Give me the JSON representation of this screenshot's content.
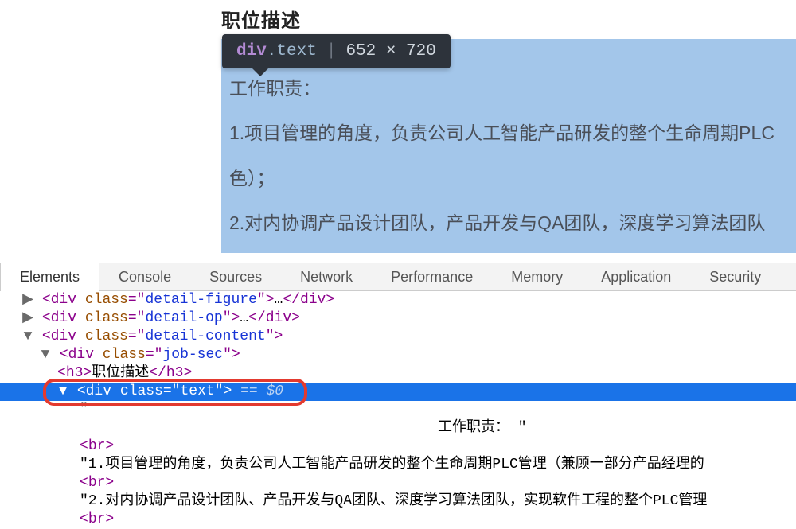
{
  "page": {
    "section_title": "职位描述",
    "highlight": {
      "line1": "工作职责：",
      "line2": "1.项目管理的角度，负责公司人工智能产品研发的整个生命周期PLC",
      "line3": "色）；",
      "line4": "2.对内协调产品设计团队，产品开发与QA团队，深度学习算法团队"
    }
  },
  "tooltip": {
    "tag": "div",
    "cls": ".text",
    "dims": "652 × 720"
  },
  "tabs": {
    "elements": "Elements",
    "console": "Console",
    "sources": "Sources",
    "network": "Network",
    "performance": "Performance",
    "memory": "Memory",
    "application": "Application",
    "security": "Security"
  },
  "dom": {
    "detail_figure": {
      "open": "<div class=\"detail-figure\">",
      "ell": "…",
      "close": "</div>"
    },
    "detail_op": {
      "open": "<div class=\"detail-op\">",
      "ell": "…",
      "close": "</div>"
    },
    "detail_content": {
      "open": "<div class=\"detail-content\">"
    },
    "job_sec": {
      "open": "<div class=\"job-sec\">"
    },
    "h3": {
      "open": "<h3>",
      "text": "职位描述",
      "close": "</h3>"
    },
    "selected": {
      "open": "<div class=\"text\">",
      "eq": " == $0"
    },
    "text_line1_open": "\"",
    "text_line1": "工作职责：",
    "text_line1_close": "\"",
    "br": "<br>",
    "text_line2": "\"1.项目管理的角度，负责公司人工智能产品研发的整个生命周期PLC管理（兼顾一部分产品经理的",
    "text_line3": "\"2.对内协调产品设计团队、产品开发与QA团队、深度学习算法团队，实现软件工程的整个PLC管理"
  }
}
